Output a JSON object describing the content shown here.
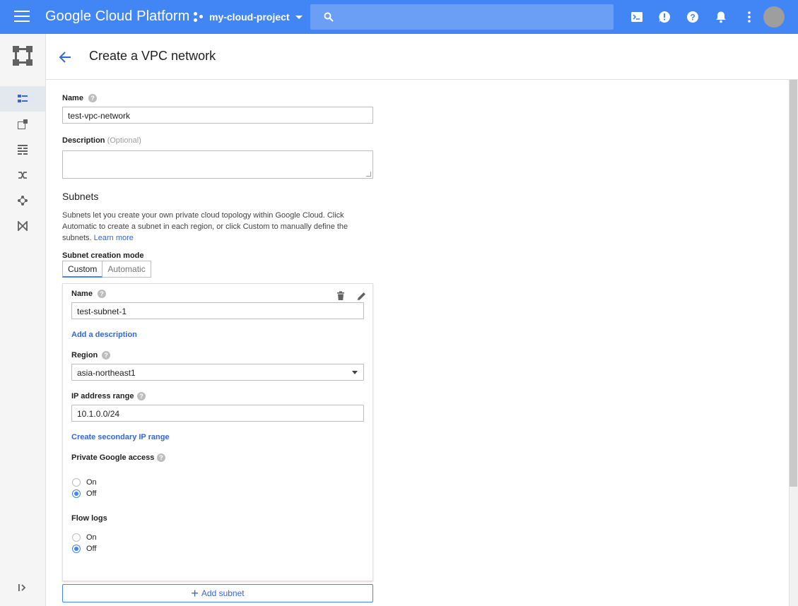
{
  "topbar": {
    "brand": "Google Cloud Platform",
    "project": "my-cloud-project"
  },
  "header": {
    "title": "Create a VPC network"
  },
  "form": {
    "name_label": "Name",
    "name_value": "test-vpc-network",
    "description_label": "Description",
    "description_optional": "(Optional)",
    "subnets_title": "Subnets",
    "subnets_desc_1": "Subnets let you create your own private cloud topology within Google Cloud. Click",
    "subnets_desc_2": "Automatic to create a subnet in each region, or click Custom to manually define the",
    "subnets_desc_3": "subnets.",
    "learn_more": "Learn more",
    "mode_label": "Subnet creation mode",
    "mode_custom": "Custom",
    "mode_automatic": "Automatic",
    "mode_selected": "Custom"
  },
  "subnet": {
    "name_label": "Name",
    "name_value": "test-subnet-1",
    "add_description": "Add a description",
    "region_label": "Region",
    "region_value": "asia-northeast1",
    "ip_label": "IP address range",
    "ip_value": "10.1.0.0/24",
    "secondary_range": "Create secondary IP range",
    "private_access_label": "Private Google access",
    "private_access_on": "On",
    "private_access_off": "Off",
    "private_access_selected": "Off",
    "flow_logs_label": "Flow logs",
    "flow_logs_on": "On",
    "flow_logs_off": "Off",
    "flow_logs_selected": "Off"
  },
  "add_subnet": "Add subnet",
  "colors": {
    "brand_blue": "#4285f4",
    "link_blue": "#3367d6"
  }
}
